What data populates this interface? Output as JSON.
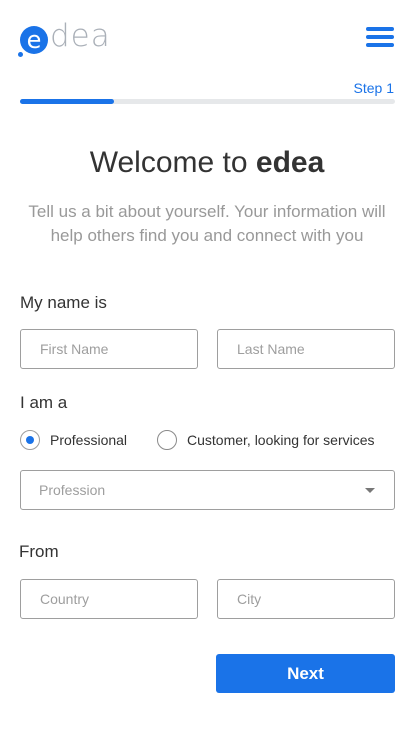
{
  "header": {
    "logo_letter": "e",
    "logo_text": "dea",
    "menu_icon": "hamburger-menu-icon"
  },
  "progress": {
    "step_label": "Step 1",
    "fraction": 0.25
  },
  "intro": {
    "title_prefix": "Welcome to ",
    "title_brand": "edea",
    "subtitle": "Tell us a bit about yourself. Your information will help others find you and connect with you"
  },
  "name_section": {
    "label": "My name is",
    "first_name_placeholder": "First Name",
    "last_name_placeholder": "Last Name"
  },
  "role_section": {
    "label": "I am a",
    "options": [
      {
        "label": "Professional",
        "checked": true
      },
      {
        "label": "Customer, looking for services",
        "checked": false
      }
    ],
    "profession_placeholder": "Profession"
  },
  "location_section": {
    "label": "From",
    "country_placeholder": "Country",
    "city_placeholder": "City"
  },
  "actions": {
    "next_label": "Next"
  },
  "colors": {
    "accent": "#1a73e8",
    "muted_text": "#999999",
    "border": "#9e9e9e"
  }
}
